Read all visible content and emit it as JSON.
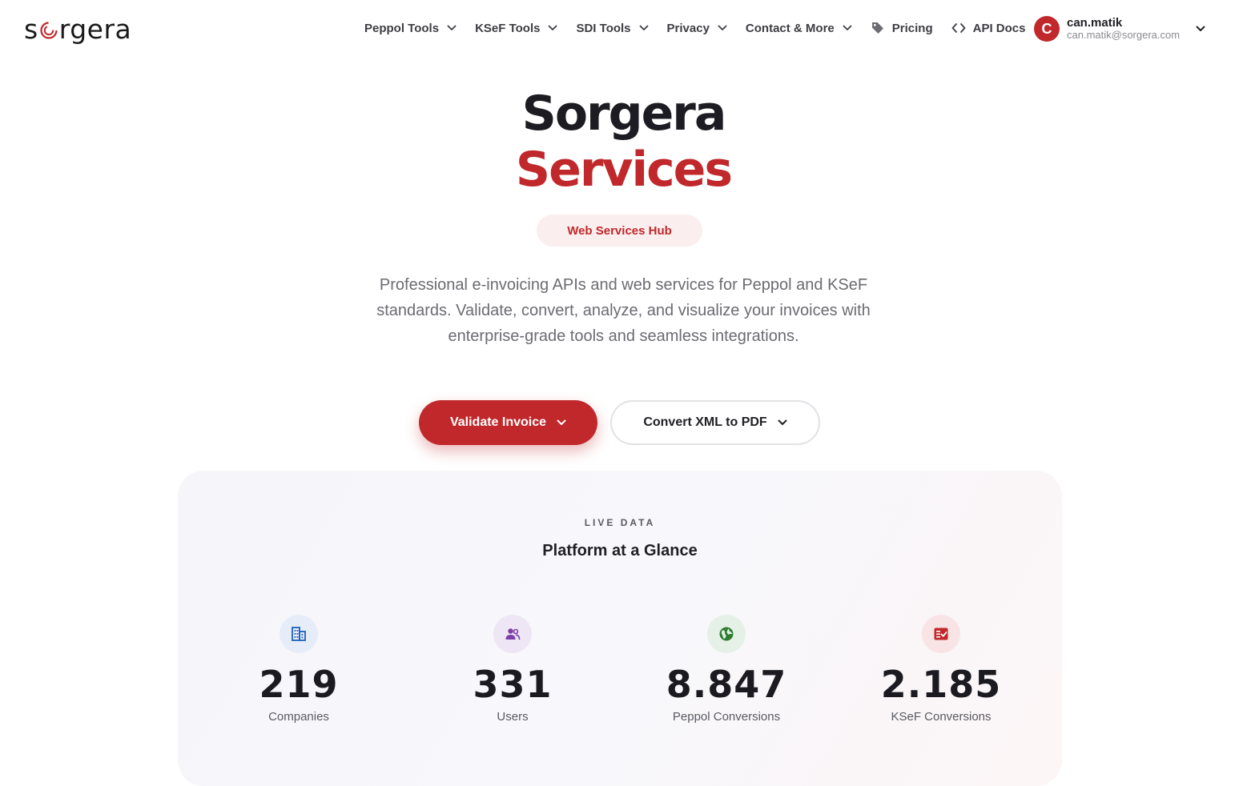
{
  "brand": {
    "logo_prefix": "s",
    "logo_suffix": "rgera",
    "accent_color": "#c0282b"
  },
  "nav": {
    "items": [
      {
        "label": "Peppol Tools",
        "icon": "chevron-down-icon"
      },
      {
        "label": "KSeF Tools",
        "icon": "chevron-down-icon"
      },
      {
        "label": "SDI Tools",
        "icon": "chevron-down-icon"
      },
      {
        "label": "Privacy",
        "icon": "chevron-down-icon"
      },
      {
        "label": "Contact & More",
        "icon": "chevron-down-icon"
      }
    ],
    "pricing": {
      "label": "Pricing",
      "icon": "tag-icon"
    },
    "api_docs": {
      "label": "API Docs",
      "icon": "code-icon"
    }
  },
  "user": {
    "initial": "C",
    "name": "can.matik",
    "email": "can.matik@sorgera.com"
  },
  "hero": {
    "title_line1": "Sorgera",
    "title_line2": "Services",
    "badge": "Web Services Hub",
    "description": "Professional e-invoicing APIs and web services for Peppol and KSeF standards. Validate, convert, analyze, and visualize your invoices with enterprise-grade tools and seamless integrations.",
    "primary_button": "Validate Invoice",
    "secondary_button": "Convert XML to PDF"
  },
  "stats": {
    "kicker": "LIVE DATA",
    "title": "Platform at a Glance",
    "items": [
      {
        "value": "219",
        "label": "Companies",
        "icon": "building-icon",
        "icon_color": "#1f5fb8",
        "icon_bg": "#e6edf8"
      },
      {
        "value": "331",
        "label": "Users",
        "icon": "users-icon",
        "icon_color": "#7b3fa8",
        "icon_bg": "#efe6f5"
      },
      {
        "value": "8.847",
        "label": "Peppol Conversions",
        "icon": "globe-icon",
        "icon_color": "#2e7d32",
        "icon_bg": "#e5f1e6"
      },
      {
        "value": "2.185",
        "label": "KSeF Conversions",
        "icon": "checklist-icon",
        "icon_color": "#c0282b",
        "icon_bg": "#f8e4e5"
      }
    ]
  }
}
